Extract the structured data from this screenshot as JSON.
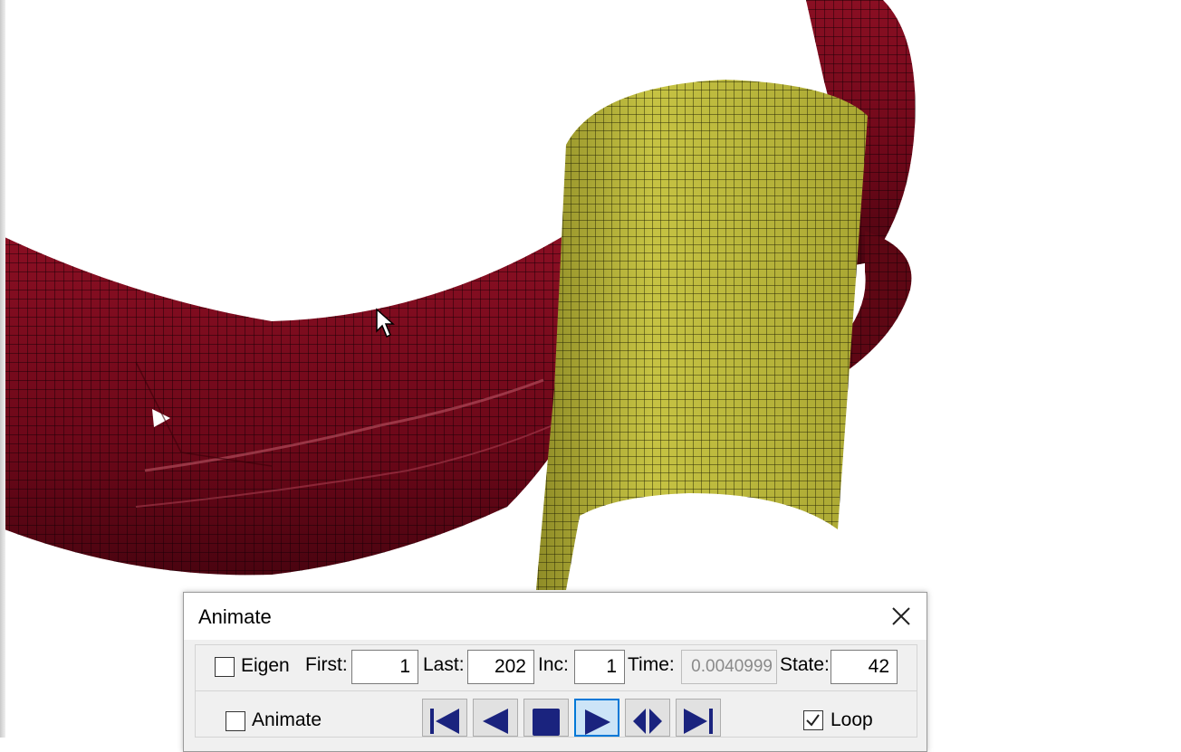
{
  "dialog": {
    "title": "Animate",
    "eigen_label": "Eigen",
    "eigen_checked": false,
    "first_label": "First:",
    "first_value": "1",
    "last_label": "Last:",
    "last_value": "202",
    "inc_label": "Inc:",
    "inc_value": "1",
    "time_label": "Time:",
    "time_value": "0.0040999",
    "state_label": "State:",
    "state_value": "42",
    "animate_label": "Animate",
    "animate_checked": false,
    "loop_label": "Loop",
    "loop_checked": true,
    "buttons": [
      {
        "icon": "skip-to-first-icon"
      },
      {
        "icon": "play-backward-icon"
      },
      {
        "icon": "stop-icon"
      },
      {
        "icon": "play-forward-icon",
        "active": true
      },
      {
        "icon": "play-back-and-forth-icon"
      },
      {
        "icon": "skip-to-last-icon"
      }
    ]
  },
  "colors": {
    "clip_part": "#7a0a1c",
    "cylinder_part": "#b5b238",
    "mesh_line": "#1a1a1a",
    "dialog_bg": "#f0f0f0",
    "accent": "#0078d7",
    "media_icon": "#1a237e"
  }
}
